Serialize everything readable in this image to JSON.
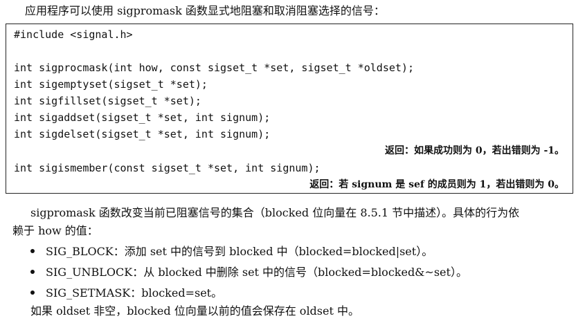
{
  "intro": "应用程序可以使用 sigpromask 函数显式地阻塞和取消阻塞选择的信号：",
  "code": {
    "include": "#include <signal.h>",
    "lines": [
      "int sigprocmask(int how, const sigset_t *set, sigset_t *oldset);",
      "int sigemptyset(sigset_t *set);",
      "int sigfillset(sigset_t *set);",
      "int sigaddset(sigset_t *set, int signum);",
      "int sigdelset(sigset_t *set, int signum);"
    ],
    "return1": "返回：如果成功则为 0，若出错则为 -1。",
    "ismember": "int sigismember(const sigset_t *set, int signum);",
    "return2": "返回：若 signum 是 sef 的成员则为 1，若出错则为 0。"
  },
  "paragraph": {
    "line1": "sigpromask 函数改变当前已阻塞信号的集合（blocked 位向量在 8.5.1 节中描述）。具体的行为依",
    "line2": "赖于 how 的值："
  },
  "bullets": [
    "SIG_BLOCK：添加 set 中的信号到 blocked 中（blocked=blocked|set）。",
    "SIG_UNBLOCK：从 blocked 中删除 set 中的信号（blocked=blocked&~set）。",
    "SIG_SETMASK：blocked=set。"
  ],
  "closing": "如果 oldset 非空，blocked 位向量以前的值会保存在 oldset 中。"
}
